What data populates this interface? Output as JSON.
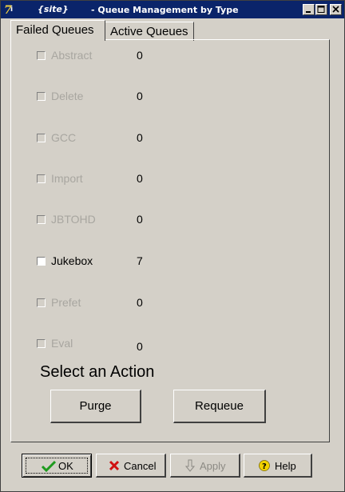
{
  "window": {
    "site": "{site}",
    "title": "- Queue Management by Type",
    "controls": [
      "minimize",
      "maximize",
      "close"
    ]
  },
  "tabs": [
    {
      "label": "Failed Queues",
      "selected": true
    },
    {
      "label": "Active Queues",
      "selected": false
    }
  ],
  "queues": [
    {
      "label": "Abstract",
      "count": "0",
      "enabled": false,
      "checked": false
    },
    {
      "label": "Delete",
      "count": "0",
      "enabled": false,
      "checked": false
    },
    {
      "label": "GCC",
      "count": "0",
      "enabled": false,
      "checked": false
    },
    {
      "label": "Import",
      "count": "0",
      "enabled": false,
      "checked": false
    },
    {
      "label": "JBTOHD",
      "count": "0",
      "enabled": false,
      "checked": false
    },
    {
      "label": "Jukebox",
      "count": "7",
      "enabled": true,
      "checked": false
    },
    {
      "label": "Prefet",
      "count": "0",
      "enabled": false,
      "checked": false
    },
    {
      "label": "Eval",
      "count": "0",
      "enabled": false,
      "checked": false
    }
  ],
  "action": {
    "heading": "Select an Action",
    "purge_label": "Purge",
    "requeue_label": "Requeue"
  },
  "buttons": {
    "ok_label": "OK",
    "cancel_label": "Cancel",
    "apply_label": "Apply",
    "help_label": "Help"
  },
  "colors": {
    "titlebar": "#0a246a",
    "face": "#d4d0c8",
    "disabled_text": "#a8a6a0",
    "ok_icon": "#1e9a1e",
    "cancel_icon": "#d01010",
    "help_icon": "#f2d200"
  }
}
